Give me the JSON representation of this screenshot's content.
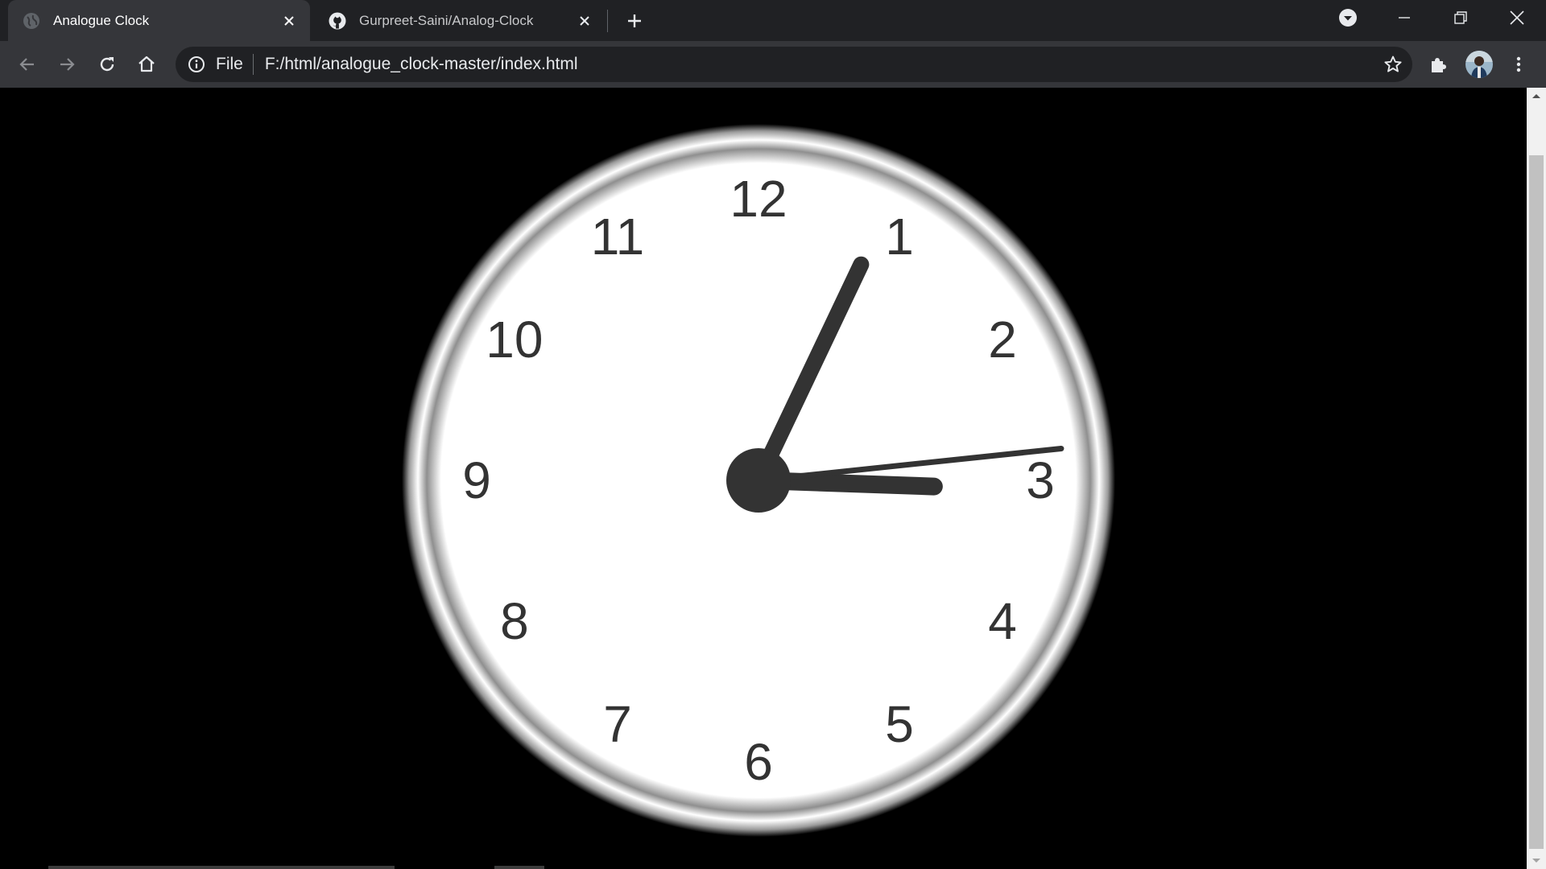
{
  "browser": {
    "tabs": [
      {
        "title": "Analogue Clock",
        "favicon": "globe-icon",
        "active": true
      },
      {
        "title": "Gurpreet-Saini/Analog-Clock",
        "favicon": "github-icon",
        "active": false
      }
    ],
    "address_bar": {
      "scheme_label": "File",
      "url": "F:/html/analogue_clock-master/index.html"
    },
    "colors": {
      "tab_strip": "#202124",
      "toolbar": "#35363a",
      "omnibox": "#202124",
      "text": "#e8eaed"
    }
  },
  "page": {
    "background": "#000000",
    "clock": {
      "numbers": [
        "12",
        "1",
        "2",
        "3",
        "4",
        "5",
        "6",
        "7",
        "8",
        "9",
        "10",
        "11"
      ],
      "time": {
        "hour": 3,
        "minute": 4,
        "second": 14
      },
      "face_color": "#ffffff",
      "hand_color": "#333333"
    }
  }
}
